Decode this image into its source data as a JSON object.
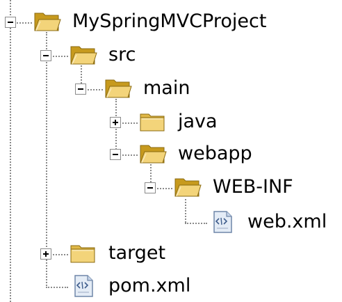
{
  "tree": {
    "nodes": [
      {
        "label": "MySpringMVCProject",
        "icon": "open-folder-icon",
        "expanded": true
      },
      {
        "label": "src",
        "icon": "open-folder-icon",
        "expanded": true
      },
      {
        "label": "main",
        "icon": "open-folder-icon",
        "expanded": true
      },
      {
        "label": "java",
        "icon": "closed-folder-icon",
        "expanded": false
      },
      {
        "label": "webapp",
        "icon": "open-folder-icon",
        "expanded": true
      },
      {
        "label": "WEB-INF",
        "icon": "open-folder-icon",
        "expanded": true
      },
      {
        "label": "web.xml",
        "icon": "xml-file-icon"
      },
      {
        "label": "target",
        "icon": "closed-folder-icon",
        "expanded": false
      },
      {
        "label": "pom.xml",
        "icon": "xml-file-icon"
      }
    ]
  },
  "colors": {
    "folder_fill": "#f3d47a",
    "folder_dark": "#c79a1e",
    "connector": "#8a8a8a",
    "file_fill": "#e4ecf6",
    "file_border": "#6f86a8"
  }
}
